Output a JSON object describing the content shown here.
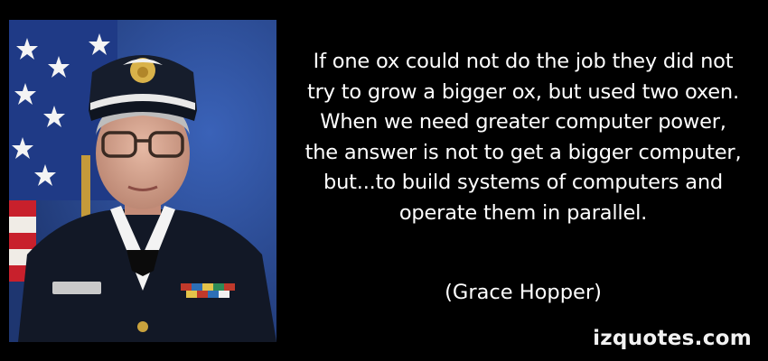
{
  "quote": {
    "text": "If one ox could not do the job they did not\ntry to grow a bigger ox, but used two oxen.\nWhen we need greater computer power,\nthe answer is not to get a bigger computer,\nbut...to build systems of computers and\noperate them in parallel.",
    "author": "(Grace Hopper)"
  },
  "watermark": "izquotes.com",
  "colors": {
    "background": "#000000",
    "text": "#ffffff",
    "flag_blue": "#2b4f9e",
    "uniform": "#121826"
  }
}
